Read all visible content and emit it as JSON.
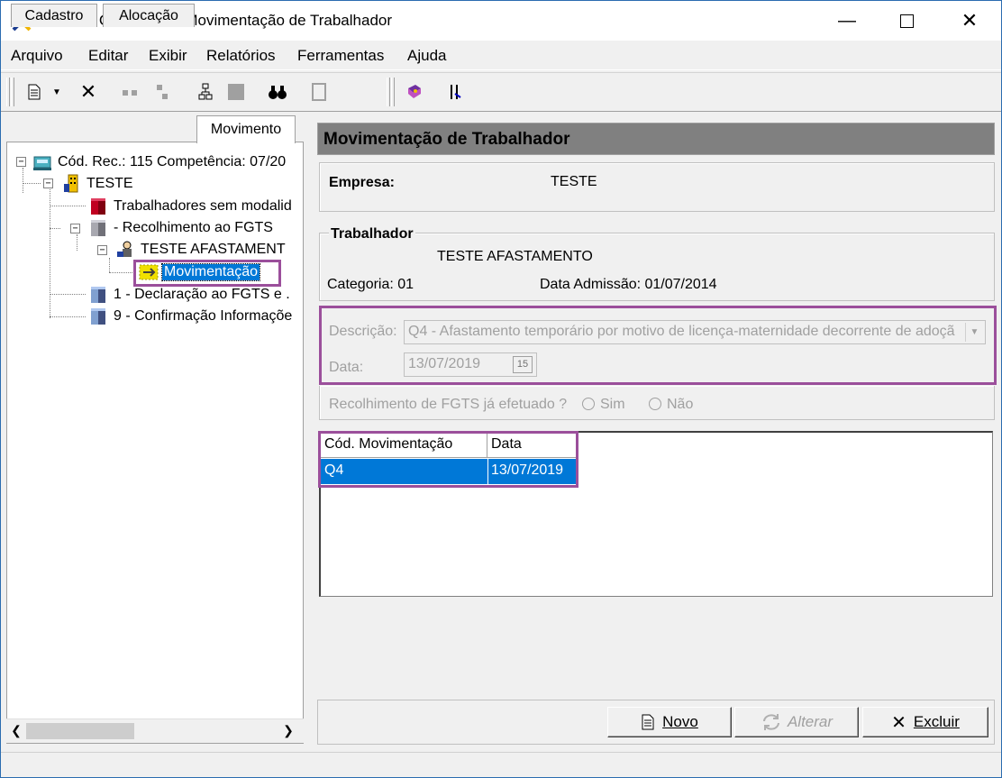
{
  "window": {
    "title": "SEFIP - Consulta de Movimentação de Trabalhador"
  },
  "menu": [
    "Arquivo",
    "Editar",
    "Exibir",
    "Relatórios",
    "Ferramentas",
    "Ajuda"
  ],
  "tabs": [
    "Cadastro",
    "Alocação",
    "Movimento"
  ],
  "tree": {
    "root": "Cód. Rec.: 115 Competência: 07/20",
    "company": "TESTE",
    "no_mode": "Trabalhadores sem modalid",
    "recolhimento": " - Recolhimento ao FGTS",
    "worker": "TESTE AFASTAMENT",
    "movimentacao": "Movimentação",
    "declaracao": "1 - Declaração ao FGTS e .",
    "confirmacao": "9 - Confirmação Informaçõe"
  },
  "panel": {
    "header": "Movimentação de Trabalhador",
    "empresa_label": "Empresa:",
    "empresa_value": "TESTE",
    "trabalhador_group": "Trabalhador",
    "trabalhador_name": "TESTE AFASTAMENTO",
    "categoria": "Categoria: 01",
    "data_admissao": "Data Admissão: 01/07/2014",
    "descricao_label": "Descrição:",
    "descricao_value": "Q4 - Afastamento temporário por motivo de licença-maternidade decorrente de adoçã",
    "data_label": "Data:",
    "data_value": "13/07/2019",
    "calendar_label": "15",
    "fgts_question": "Recolhimento de FGTS já efetuado ?",
    "sim": "Sim",
    "nao": "Não"
  },
  "table": {
    "headers": [
      "Cód. Movimentação",
      "Data"
    ],
    "rows": [
      {
        "cod": "Q4",
        "data": "13/07/2019"
      }
    ]
  },
  "buttons": {
    "novo": "Novo",
    "alterar": "Alterar",
    "excluir": "Excluir"
  },
  "colors": {
    "highlight": "#9b4f9b",
    "selection": "#0078d7",
    "header_bg": "#808080"
  }
}
